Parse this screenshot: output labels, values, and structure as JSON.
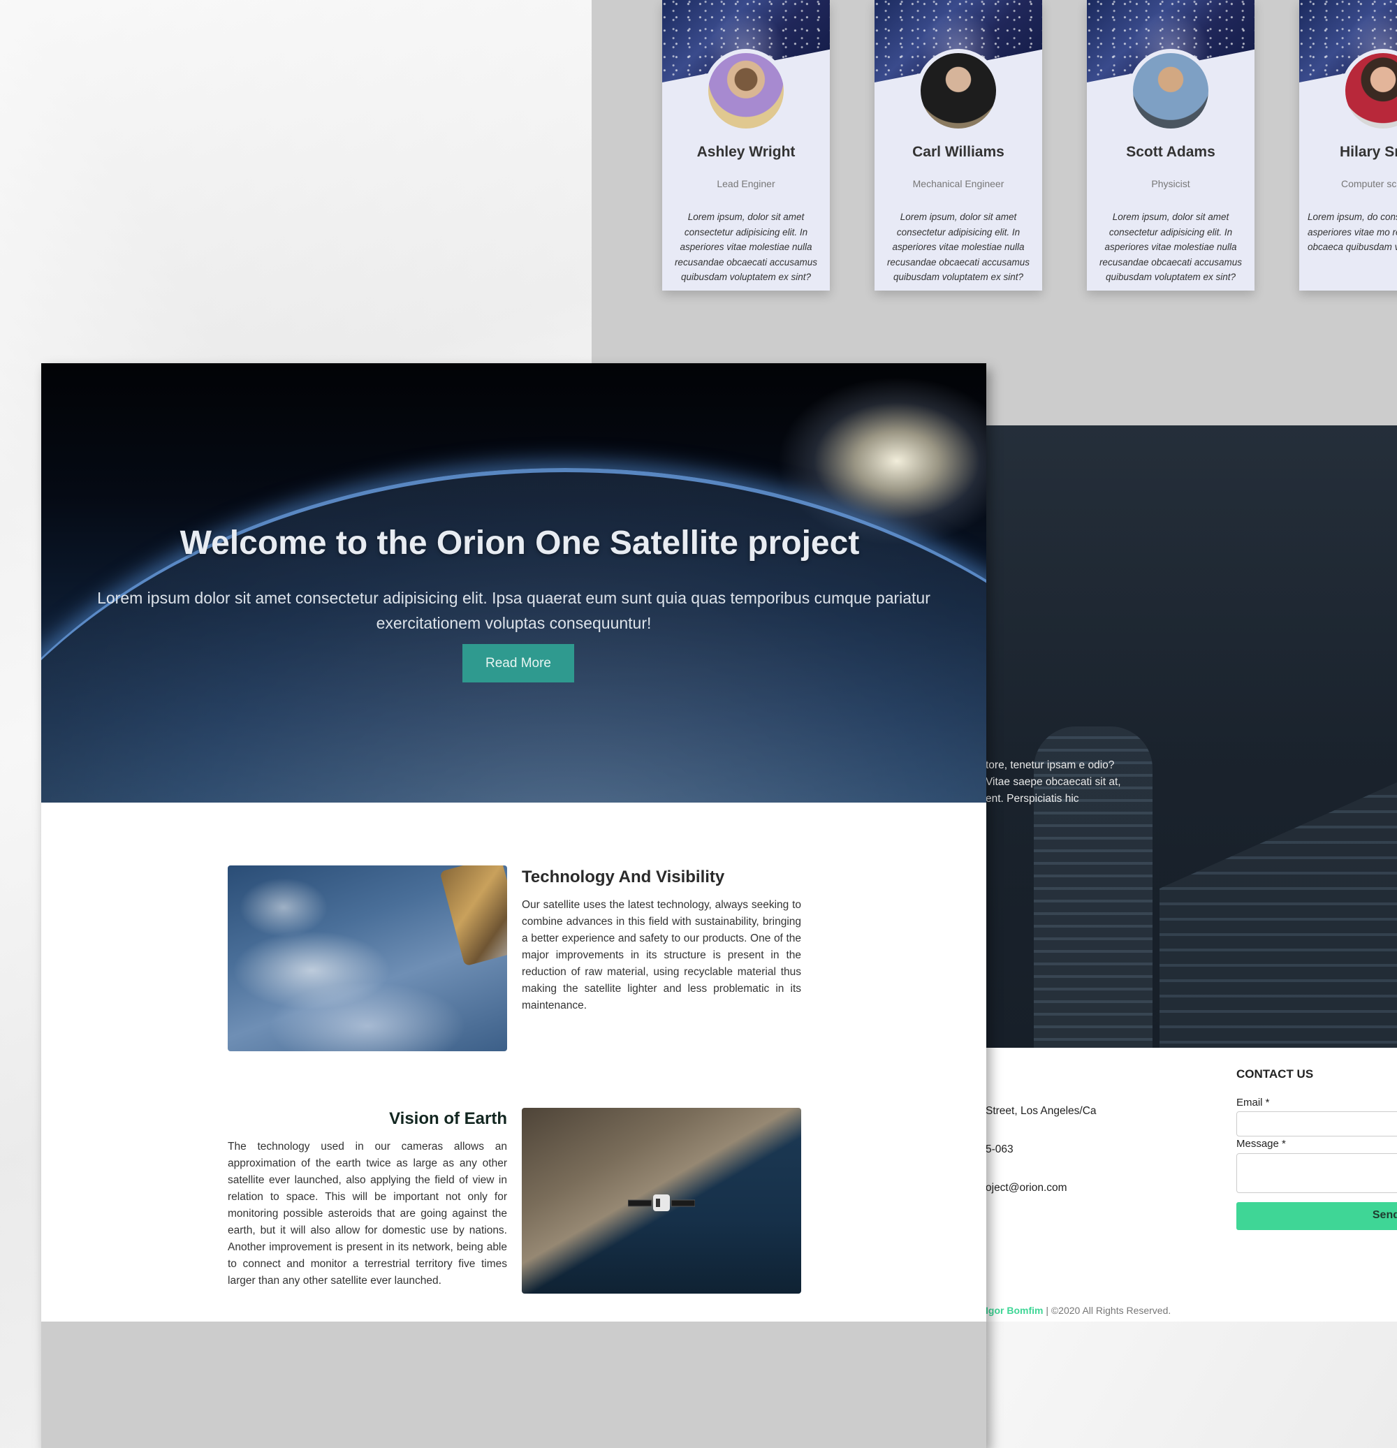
{
  "team": {
    "members": [
      {
        "name": "Ashley Wright",
        "role": "Lead Enginer",
        "bio": "Lorem ipsum, dolor sit amet consectetur adipisicing elit. In asperiores vitae molestiae nulla recusandae obcaecati accusamus quibusdam voluptatem ex sint?",
        "avatar_color": "#b48a5e"
      },
      {
        "name": "Carl Williams",
        "role": "Mechanical Engineer",
        "bio": "Lorem ipsum, dolor sit amet consectetur adipisicing elit. In asperiores vitae molestiae nulla recusandae obcaecati accusamus quibusdam voluptatem ex sint?",
        "avatar_color": "#3b3b3b"
      },
      {
        "name": "Scott Adams",
        "role": "Physicist",
        "bio": "Lorem ipsum, dolor sit amet consectetur adipisicing elit. In asperiores vitae molestiae nulla recusandae obcaecati accusamus quibusdam voluptatem ex sint?",
        "avatar_color": "#6a7a8a"
      },
      {
        "name": "Hilary Sr",
        "role": "Computer sc",
        "bio": "Lorem ipsum, do consectetur adipis asperiores vitae mo recusandae obcaeca quibusdam volupta",
        "avatar_color": "#c23a45"
      }
    ]
  },
  "hero": {
    "title": "Welcome to the Orion One Satellite project",
    "subtitle": "Lorem ipsum dolor sit amet consectetur adipisicing elit. Ipsa quaerat eum sunt quia quas temporibus cumque pariatur exercitationem voluptas consequuntur!",
    "button_label": "Read More"
  },
  "features": [
    {
      "title": "Technology And Visibility",
      "text": "Our satellite uses the latest technology, always seeking to combine advances in this field with sustainability, bringing a better experience and safety to our products. One of the major improvements in its structure is present in the reduction of raw material, using recyclable material thus making the satellite lighter and less problematic in its maintenance."
    },
    {
      "title": "Vision of Earth",
      "text": "The technology used in our cameras allows an approximation of the earth twice as large as any other satellite ever launched, also applying the field of view in relation to space. This will be important not only for monitoring possible asteroids that are going against the earth, but it will also allow for domestic use by nations. Another improvement is present in its network, being able to connect and monitor a terrestrial territory five times larger than any other satellite ever launched."
    }
  ],
  "about": {
    "text": "tore, tenetur ipsam e odio? Vitae saepe obcaecati sit at, ent. Perspiciatis hic"
  },
  "contact": {
    "title": "CONTACT US",
    "email_label": "Email *",
    "message_label": "Message *",
    "send_label": "Send",
    "address": "Street, Los Angeles/Ca",
    "phone": "5-063",
    "email": "oject@orion.com"
  },
  "footer": {
    "author": "Igor Bomfim",
    "rights": " | ©2020 All Rights Reserved."
  },
  "colors": {
    "accent": "#3fd696",
    "hero_button": "#2f9a8f",
    "card_bg": "#e8eaf6"
  }
}
